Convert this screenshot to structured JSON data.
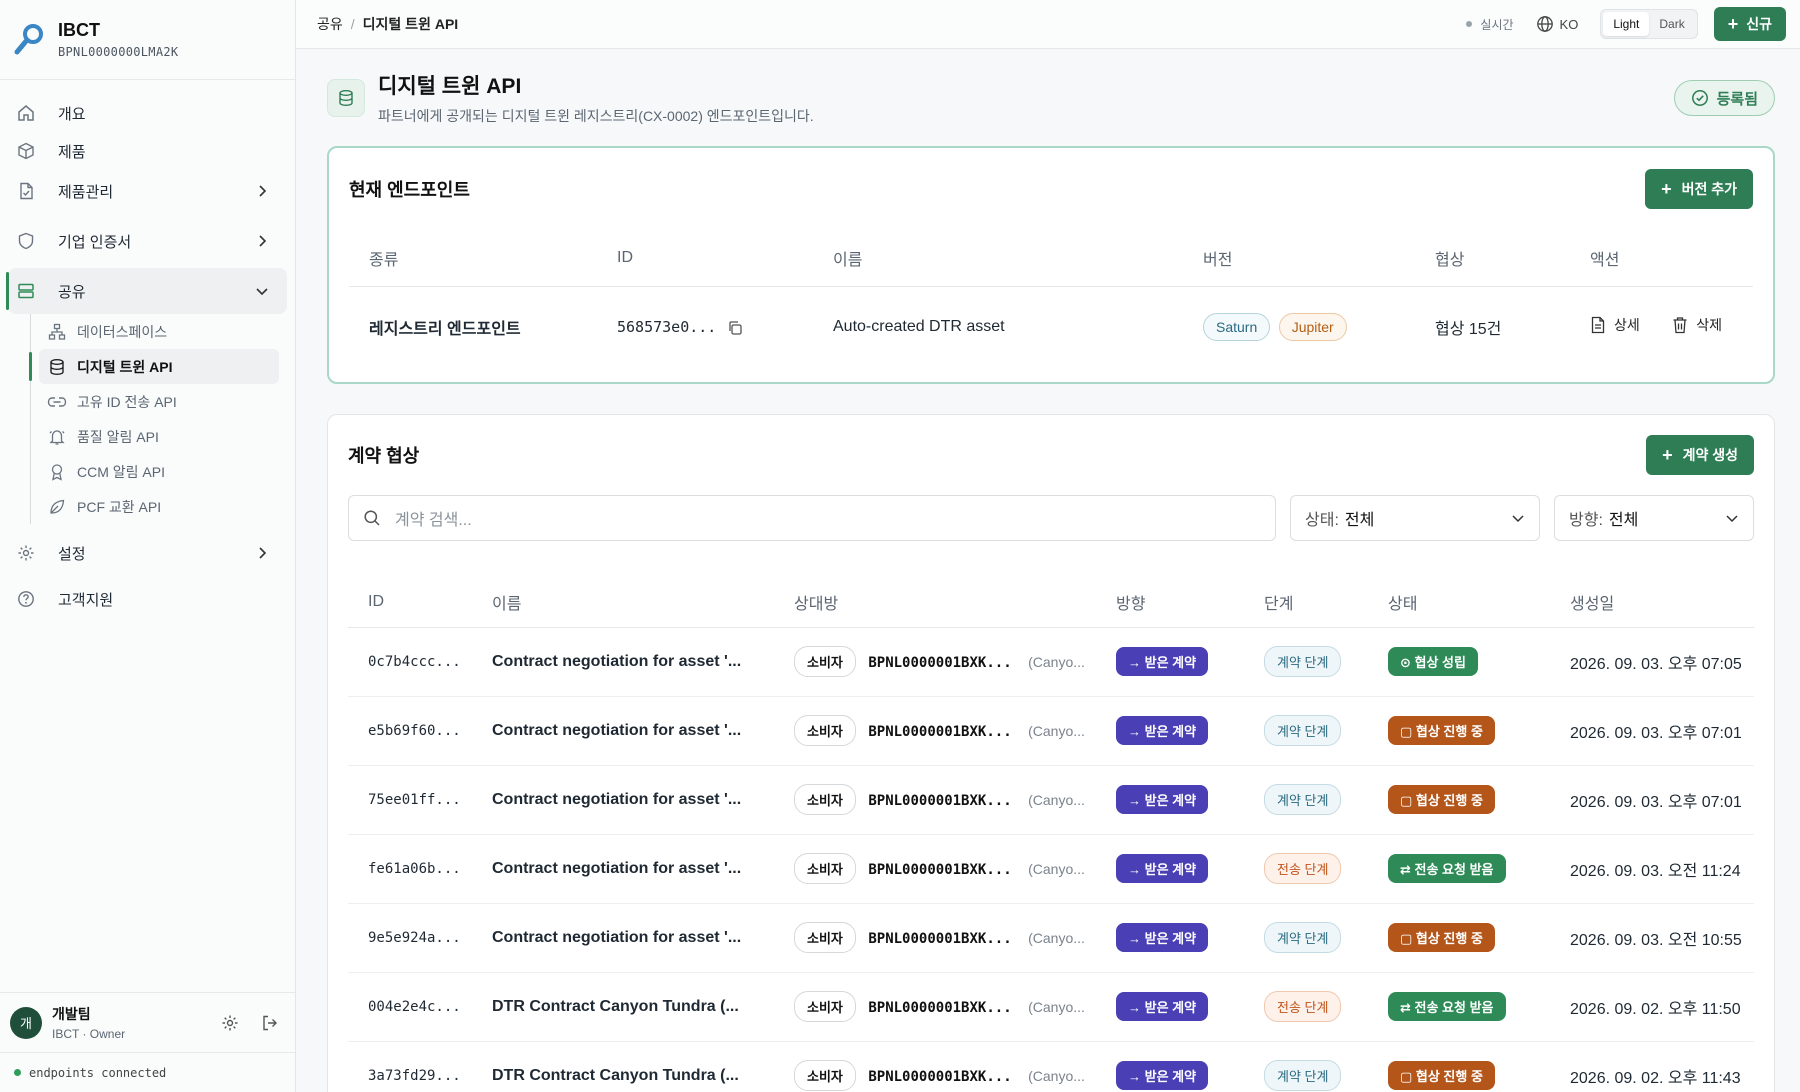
{
  "brand": {
    "name": "IBCT",
    "id": "BPNL0000000LMA2K"
  },
  "nav": {
    "items": [
      {
        "label": "개요",
        "icon": "home-icon"
      },
      {
        "label": "제품",
        "icon": "box-icon"
      },
      {
        "label": "제품관리",
        "icon": "file-check-icon"
      },
      {
        "label": "기업 인증서",
        "icon": "shield-icon"
      },
      {
        "label": "공유",
        "icon": "server-icon"
      }
    ],
    "sub": [
      {
        "label": "데이터스페이스",
        "icon": "network-icon"
      },
      {
        "label": "디지털 트윈 API",
        "icon": "database-icon"
      },
      {
        "label": "고유 ID 전송 API",
        "icon": "link-icon"
      },
      {
        "label": "품질 알림 API",
        "icon": "bell-icon"
      },
      {
        "label": "CCM 알림 API",
        "icon": "award-icon"
      },
      {
        "label": "PCF 교환 API",
        "icon": "leaf-icon"
      }
    ],
    "settings": "설정",
    "support": "고객지원"
  },
  "user": {
    "avatar": "개",
    "name": "개발팀",
    "role": "IBCT · Owner"
  },
  "footer_status": "endpoints connected",
  "topbar": {
    "crumb_root": "공유",
    "crumb_sep": "/",
    "crumb_current": "디지털 트윈 API",
    "realtime": "실시간",
    "lang": "KO",
    "theme_light": "Light",
    "theme_dark": "Dark",
    "new_label": "신규"
  },
  "page": {
    "title": "디지털 트윈 API",
    "subtitle": "파트너에게 공개되는 디지털 트윈 레지스트리(CX-0002) 엔드포인트입니다.",
    "badge": "등록됨"
  },
  "endpoints": {
    "title": "현재 엔드포인트",
    "add_version": "버전 추가",
    "columns": [
      "종류",
      "ID",
      "이름",
      "버전",
      "협상",
      "액션"
    ],
    "row": {
      "type": "레지스트리 엔드포인트",
      "id": "568573e0...",
      "name": "Auto-created DTR asset",
      "versions": [
        "Saturn",
        "Jupiter"
      ],
      "negotiations": "협상 15건",
      "detail": "상세",
      "delete": "삭제"
    }
  },
  "contracts": {
    "title": "계약 협상",
    "create": "계약 생성",
    "search_placeholder": "계약 검색...",
    "filter_state_label": "상태:",
    "filter_state_value": "전체",
    "filter_dir_label": "방향:",
    "filter_dir_value": "전체",
    "columns": [
      "ID",
      "이름",
      "상대방",
      "방향",
      "단계",
      "상태",
      "생성일"
    ],
    "rows": [
      {
        "id": "0c7b4ccc...",
        "name": "Contract negotiation for asset '...",
        "role": "소비자",
        "bpn": "BPNL0000001BXK...",
        "cp": "(Canyo...",
        "direction": "→ 받은 계약",
        "stage": "계약 단계",
        "stage_type": "contract",
        "state": "⊙ 협상 성립",
        "state_type": "done",
        "date": "2026. 09. 03. 오후 07:05"
      },
      {
        "id": "e5b69f60...",
        "name": "Contract negotiation for asset '...",
        "role": "소비자",
        "bpn": "BPNL0000001BXK...",
        "cp": "(Canyo...",
        "direction": "→ 받은 계약",
        "stage": "계약 단계",
        "stage_type": "contract",
        "state": "▢ 협상 진행 중",
        "state_type": "prog",
        "date": "2026. 09. 03. 오후 07:01"
      },
      {
        "id": "75ee01ff...",
        "name": "Contract negotiation for asset '...",
        "role": "소비자",
        "bpn": "BPNL0000001BXK...",
        "cp": "(Canyo...",
        "direction": "→ 받은 계약",
        "stage": "계약 단계",
        "stage_type": "contract",
        "state": "▢ 협상 진행 중",
        "state_type": "prog",
        "date": "2026. 09. 03. 오후 07:01"
      },
      {
        "id": "fe61a06b...",
        "name": "Contract negotiation for asset '...",
        "role": "소비자",
        "bpn": "BPNL0000001BXK...",
        "cp": "(Canyo...",
        "direction": "→ 받은 계약",
        "stage": "전송 단계",
        "stage_type": "transfer",
        "state": "⇄ 전송 요청 받음",
        "state_type": "req",
        "date": "2026. 09. 03. 오전 11:24"
      },
      {
        "id": "9e5e924a...",
        "name": "Contract negotiation for asset '...",
        "role": "소비자",
        "bpn": "BPNL0000001BXK...",
        "cp": "(Canyo...",
        "direction": "→ 받은 계약",
        "stage": "계약 단계",
        "stage_type": "contract",
        "state": "▢ 협상 진행 중",
        "state_type": "prog",
        "date": "2026. 09. 03. 오전 10:55"
      },
      {
        "id": "004e2e4c...",
        "name": "DTR Contract Canyon Tundra (...",
        "role": "소비자",
        "bpn": "BPNL0000001BXK...",
        "cp": "(Canyo...",
        "direction": "→ 받은 계약",
        "stage": "전송 단계",
        "stage_type": "transfer",
        "state": "⇄ 전송 요청 받음",
        "state_type": "req",
        "date": "2026. 09. 02. 오후 11:50"
      },
      {
        "id": "3a73fd29...",
        "name": "DTR Contract Canyon Tundra (...",
        "role": "소비자",
        "bpn": "BPNL0000001BXK...",
        "cp": "(Canyo...",
        "direction": "→ 받은 계약",
        "stage": "계약 단계",
        "stage_type": "contract",
        "state": "▢ 협상 진행 중",
        "state_type": "prog",
        "date": "2026. 09. 02. 오후 11:43"
      }
    ]
  },
  "colors": {
    "accent": "#2e7d55",
    "direction": "#4a3fb5",
    "progress": "#b4561a"
  }
}
